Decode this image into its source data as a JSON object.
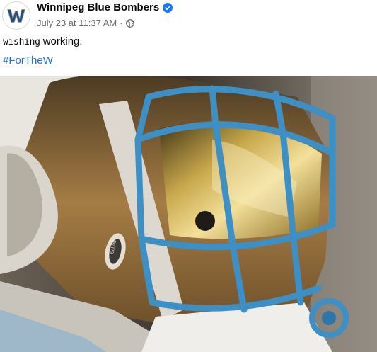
{
  "post": {
    "page_name": "Winnipeg Blue Bombers",
    "verified": true,
    "timestamp": "July 23 at 11:37 AM",
    "separator": "·",
    "audience_icon": "globe-icon",
    "text_struck": "wishing",
    "text_rest": "working.",
    "hashtag": "#ForTheW",
    "hashtag_color": "#216fdb",
    "avatar_logo_letter": "W",
    "media": {
      "description_icon": "photo",
      "helmet_brand_label": "Schutt"
    }
  },
  "colors": {
    "brand_blue": "#1d4f91",
    "verified_blue": "#1877f2",
    "facemask_blue": "#3d8fc4",
    "secondary_text": "#65676b"
  }
}
